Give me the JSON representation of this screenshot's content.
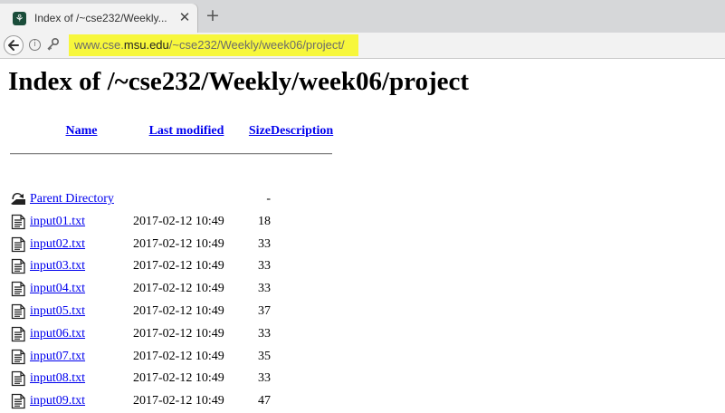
{
  "browser": {
    "tab_title": "Index of /~cse232/Weekly...",
    "tab_close": "✕",
    "new_tab": "+",
    "url": {
      "prefix": "www.cse.",
      "host": "msu.edu",
      "path": "/~cse232/Weekly/week06/project/"
    },
    "highlight_color": "#f7f73c"
  },
  "page": {
    "title": "Index of /~cse232/Weekly/week06/project",
    "columns": {
      "name": "Name",
      "modified": "Last modified",
      "size": "Size",
      "description": "Description"
    },
    "parent": {
      "name": "Parent Directory",
      "size": "-"
    },
    "files": [
      {
        "name": "input01.txt",
        "modified": "2017-02-12 10:49",
        "size": "18"
      },
      {
        "name": "input02.txt",
        "modified": "2017-02-12 10:49",
        "size": "33"
      },
      {
        "name": "input03.txt",
        "modified": "2017-02-12 10:49",
        "size": "33"
      },
      {
        "name": "input04.txt",
        "modified": "2017-02-12 10:49",
        "size": "33"
      },
      {
        "name": "input05.txt",
        "modified": "2017-02-12 10:49",
        "size": "37"
      },
      {
        "name": "input06.txt",
        "modified": "2017-02-12 10:49",
        "size": "33"
      },
      {
        "name": "input07.txt",
        "modified": "2017-02-12 10:49",
        "size": "35"
      },
      {
        "name": "input08.txt",
        "modified": "2017-02-12 10:49",
        "size": "33"
      },
      {
        "name": "input09.txt",
        "modified": "2017-02-12 10:49",
        "size": "47"
      }
    ],
    "link_color": "#0000ee"
  }
}
